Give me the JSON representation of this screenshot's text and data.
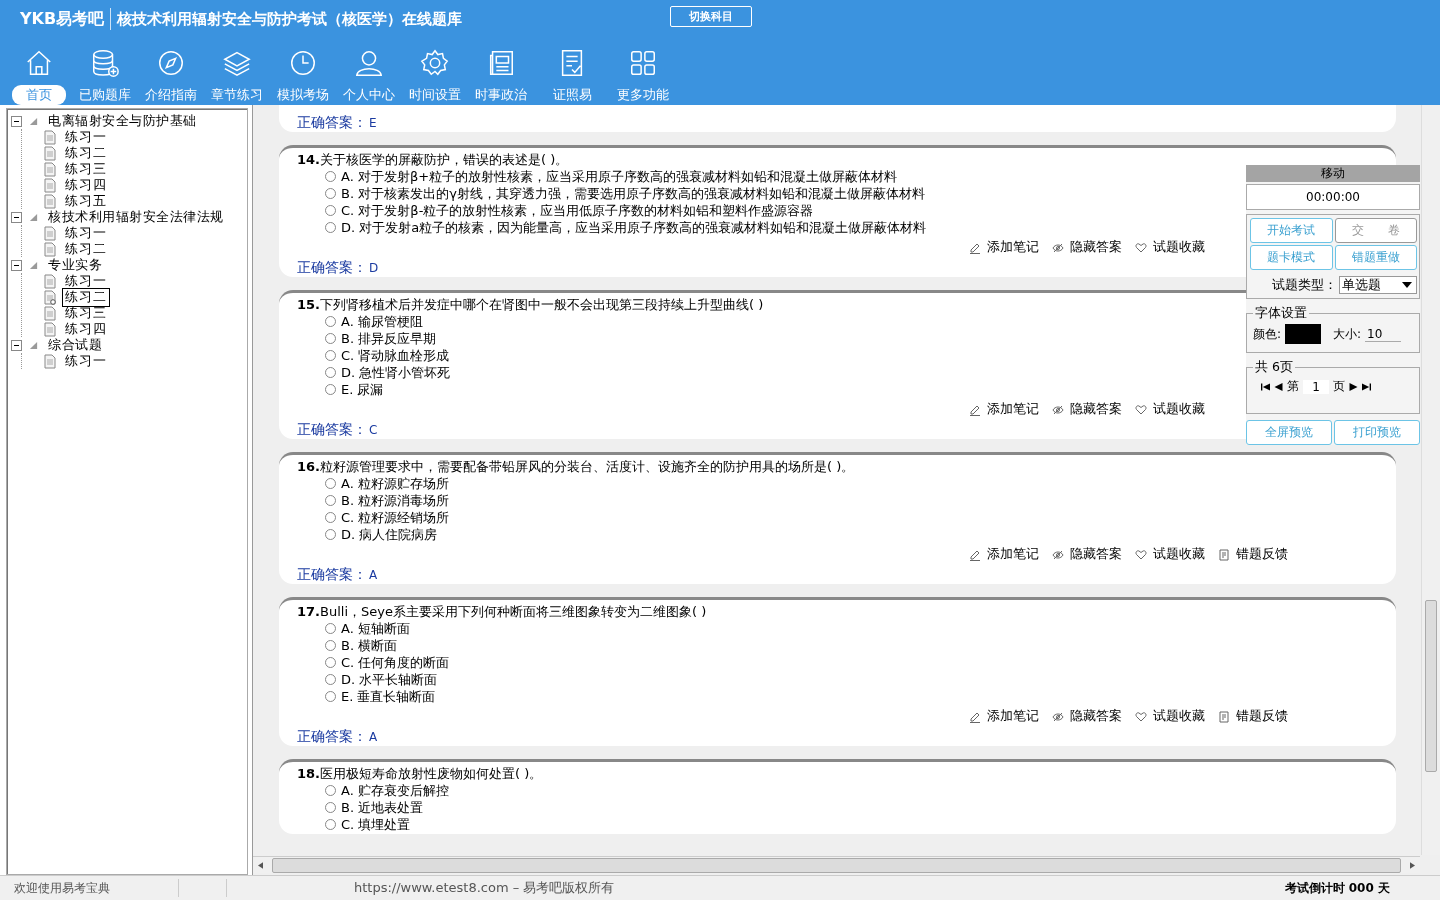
{
  "header": {
    "logo": "YKB易考吧",
    "title": "核技术利用辐射安全与防护考试（核医学）在线题库",
    "switch_button": "切换科目"
  },
  "nav": [
    {
      "label": "首页",
      "selected": true
    },
    {
      "label": "已购题库",
      "selected": false
    },
    {
      "label": "介绍指南",
      "selected": false
    },
    {
      "label": "章节练习",
      "selected": false
    },
    {
      "label": "模拟考场",
      "selected": false
    },
    {
      "label": "个人中心",
      "selected": false
    },
    {
      "label": "时间设置",
      "selected": false
    },
    {
      "label": "时事政治",
      "selected": false
    },
    {
      "label": "证照易",
      "selected": false
    },
    {
      "label": "更多功能",
      "selected": false
    }
  ],
  "tree": [
    {
      "label": "电离辐射安全与防护基础",
      "expanded": true,
      "children": [
        {
          "label": "练习一",
          "selected": false
        },
        {
          "label": "练习二",
          "selected": false
        },
        {
          "label": "练习三",
          "selected": false
        },
        {
          "label": "练习四",
          "selected": false
        },
        {
          "label": "练习五",
          "selected": false
        }
      ]
    },
    {
      "label": "核技术利用辐射安全法律法规",
      "expanded": true,
      "children": [
        {
          "label": "练习一",
          "selected": false
        },
        {
          "label": "练习二",
          "selected": false
        }
      ]
    },
    {
      "label": "专业实务",
      "expanded": true,
      "children": [
        {
          "label": "练习一",
          "selected": false
        },
        {
          "label": "练习二",
          "selected": true
        },
        {
          "label": "练习三",
          "selected": false
        },
        {
          "label": "练习四",
          "selected": false
        }
      ]
    },
    {
      "label": "综合试题",
      "expanded": true,
      "children": [
        {
          "label": "练习一",
          "selected": false
        }
      ]
    }
  ],
  "questions": [
    {
      "answer_label": "正确答案：",
      "answer": "E"
    },
    {
      "number": "14.",
      "text": "关于核医学的屏蔽防护，错误的表述是( )。",
      "options": [
        {
          "letter": "A.",
          "text": "对于发射β+粒子的放射性核素，应当采用原子序数高的强衰减材料如铅和混凝土做屏蔽体材料",
          "selected": false
        },
        {
          "letter": "B.",
          "text": "对于核素发出的γ射线，其穿透力强，需要选用原子序数高的强衰减材料如铅和混凝土做屏蔽体材料",
          "selected": false
        },
        {
          "letter": "C.",
          "text": "对于发射β-粒子的放射性核素，应当用低原子序数的材料如铝和塑料作盛源容器",
          "selected": false
        },
        {
          "letter": "D.",
          "text": "对于发射a粒子的核素，因为能量高，应当采用原子序数高的强衰减材料如铅和混凝土做屏蔽体材料",
          "selected": false
        }
      ],
      "actions": [
        "添加笔记",
        "隐藏答案",
        "试题收藏"
      ],
      "answer_label": "正确答案：",
      "answer": "D"
    },
    {
      "number": "15.",
      "text": "下列肾移植术后并发症中哪个在肾图中一般不会出现第三段持续上升型曲线( )",
      "options": [
        {
          "letter": "A.",
          "text": "输尿管梗阻",
          "selected": false
        },
        {
          "letter": "B.",
          "text": "排异反应早期",
          "selected": false
        },
        {
          "letter": "C.",
          "text": "肾动脉血栓形成",
          "selected": false
        },
        {
          "letter": "D.",
          "text": "急性肾小管坏死",
          "selected": false
        },
        {
          "letter": "E.",
          "text": "尿漏",
          "selected": false
        }
      ],
      "actions": [
        "添加笔记",
        "隐藏答案",
        "试题收藏"
      ],
      "answer_label": "正确答案：",
      "answer": "C"
    },
    {
      "number": "16.",
      "text": "粒籽源管理要求中，需要配备带铅屏风的分装台、活度计、设施齐全的防护用具的场所是( )。",
      "options": [
        {
          "letter": "A.",
          "text": "粒籽源贮存场所",
          "selected": false
        },
        {
          "letter": "B.",
          "text": "粒籽源消毒场所",
          "selected": false
        },
        {
          "letter": "C.",
          "text": "粒籽源经销场所",
          "selected": false
        },
        {
          "letter": "D.",
          "text": "病人住院病房",
          "selected": false
        }
      ],
      "actions": [
        "添加笔记",
        "隐藏答案",
        "试题收藏",
        "错题反馈"
      ],
      "answer_label": "正确答案：",
      "answer": "A"
    },
    {
      "number": "17.",
      "text": "Bulli，Seye系主要采用下列何种断面将三维图象转变为二维图象( )",
      "options": [
        {
          "letter": "A.",
          "text": "短轴断面",
          "selected": false
        },
        {
          "letter": "B.",
          "text": "横断面",
          "selected": false
        },
        {
          "letter": "C.",
          "text": "任何角度的断面",
          "selected": false
        },
        {
          "letter": "D.",
          "text": "水平长轴断面",
          "selected": false
        },
        {
          "letter": "E.",
          "text": "垂直长轴断面",
          "selected": false
        }
      ],
      "actions": [
        "添加笔记",
        "隐藏答案",
        "试题收藏",
        "错题反馈"
      ],
      "answer_label": "正确答案：",
      "answer": "A"
    },
    {
      "number": "18.",
      "text": "医用极短寿命放射性废物如何处置( )。",
      "options": [
        {
          "letter": "A.",
          "text": "贮存衰变后解控",
          "selected": false
        },
        {
          "letter": "B.",
          "text": "近地表处置",
          "selected": false
        },
        {
          "letter": "C.",
          "text": "填埋处置",
          "selected": false
        }
      ]
    }
  ],
  "panel": {
    "title": "移动",
    "timer": "00:00:00",
    "buttons": [
      "开始考试",
      "交　　卷",
      "题卡模式",
      "错题重做"
    ],
    "type_label": "试题类型：",
    "type_value": "单选题",
    "font_legend": "字体设置",
    "color_label": "颜色:",
    "color": "#000000",
    "size_label": "大小:",
    "size_value": "10",
    "pages_legend": "共 6页",
    "page_prefix": "第",
    "page_value": "1",
    "page_suffix": "页",
    "bottom_buttons": [
      "全屏预览",
      "打印预览"
    ]
  },
  "status": {
    "welcome": "欢迎使用易考宝典",
    "copyright": "https://www.etest8.com – 易考吧版权所有",
    "countdown": "考试倒计时 000 天"
  }
}
